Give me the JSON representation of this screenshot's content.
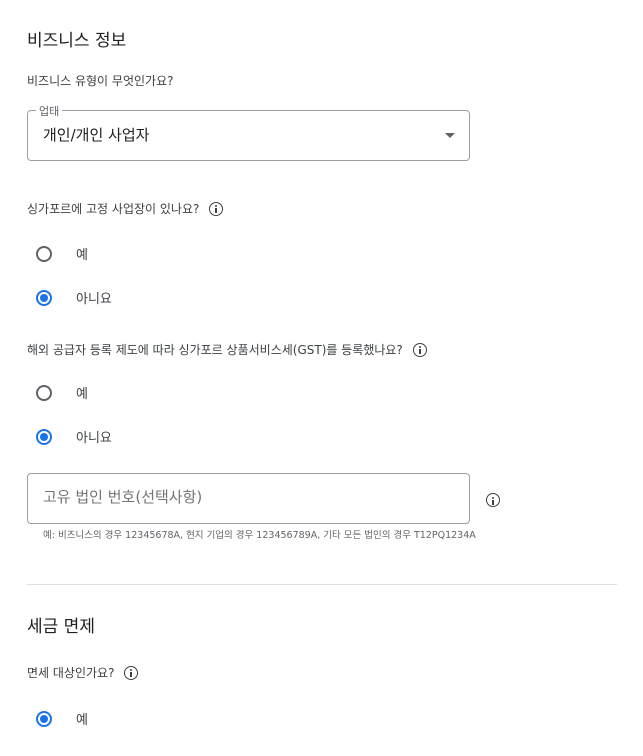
{
  "business_info": {
    "title": "비즈니스 정보",
    "type_question": "비즈니스 유형이 무엇인가요?",
    "type_select": {
      "legend": "업태",
      "value": "개인/개인 사업자"
    },
    "fixed_place_question": "싱가포르에 고정 사업장이 있나요?",
    "fixed_place_options": [
      {
        "label": "예",
        "checked": false
      },
      {
        "label": "아니요",
        "checked": true
      }
    ],
    "gst_question": "해외 공급자 등록 제도에 따라 싱가포르 상품서비스세(GST)를 등록했나요?",
    "gst_options": [
      {
        "label": "예",
        "checked": false
      },
      {
        "label": "아니요",
        "checked": true
      }
    ],
    "entity_number": {
      "placeholder": "고유 법인 번호(선택사항)",
      "helper": "예: 비즈니스의 경우 12345678A, 현지 기업의 경우 123456789A, 기타 모든 법인의 경우 T12PQ1234A"
    }
  },
  "tax_exemption": {
    "title": "세금 면제",
    "question": "면세 대상인가요?",
    "options": [
      {
        "label": "예",
        "checked": true
      }
    ]
  },
  "colors": {
    "accent": "#1a73e8",
    "text": "#202124",
    "secondary": "#5f6368"
  },
  "icons": {
    "info": "info-circle-icon",
    "dropdown": "caret-down-icon"
  }
}
